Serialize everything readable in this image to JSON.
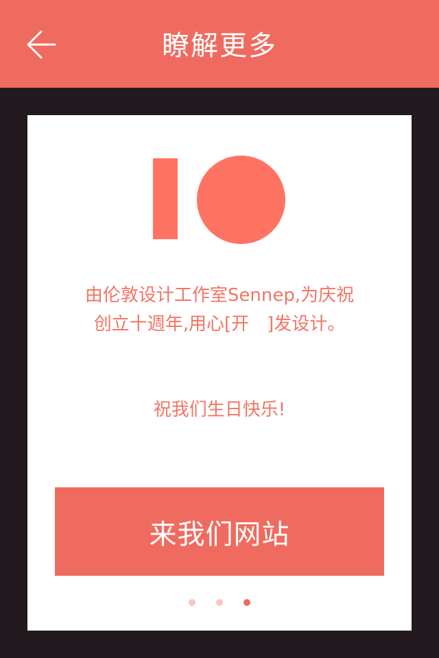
{
  "header": {
    "title": "瞭解更多",
    "back_icon": "arrow-left-icon"
  },
  "card": {
    "logo": {
      "text": "IO",
      "color": "#ff7363"
    },
    "description": "由伦敦设计工作室Sennep,为庆祝创立十週年,用心[开　]发设计。",
    "greeting": "祝我们生日快乐!",
    "cta_label": "来我们网站"
  },
  "pagination": {
    "total": 3,
    "current": 3
  },
  "colors": {
    "accent": "#f06b5f",
    "logo": "#ff7363",
    "text_accent": "#f27565",
    "background": "#231a1f",
    "card": "#ffffff",
    "dot_inactive": "#f9c6bf"
  }
}
